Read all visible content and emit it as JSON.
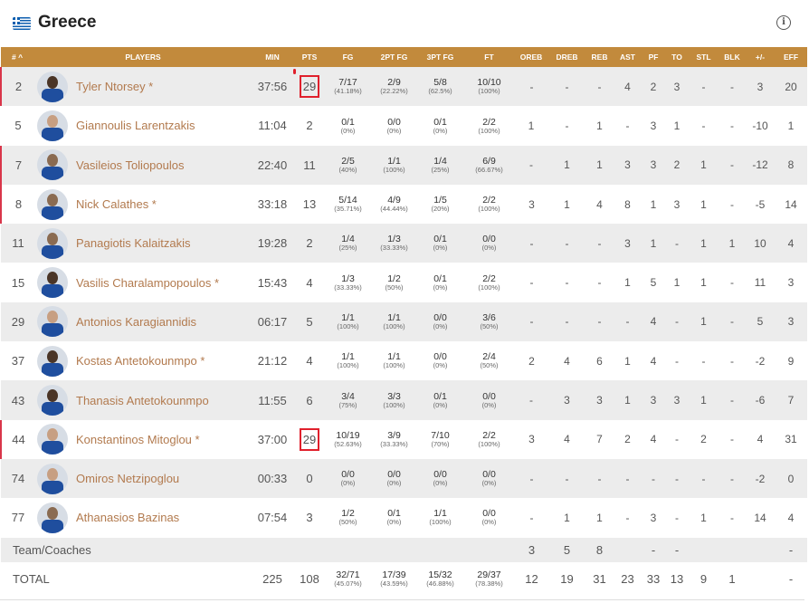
{
  "team": {
    "name": "Greece",
    "flag": "greece-flag",
    "info": "i"
  },
  "columns": [
    "# ^",
    "PLAYERS",
    "MIN",
    "PTS",
    "FG",
    "2PT FG",
    "3PT FG",
    "FT",
    "OREB",
    "DREB",
    "REB",
    "AST",
    "PF",
    "TO",
    "STL",
    "BLK",
    "+/-",
    "EFF"
  ],
  "players": [
    {
      "no": "2",
      "name": "Tyler Ntorsey *",
      "min": "37:56",
      "pts": "29",
      "fg": [
        "7/17",
        "(41.18%)"
      ],
      "fg2": [
        "2/9",
        "(22.22%)"
      ],
      "fg3": [
        "5/8",
        "(62.5%)"
      ],
      "ft": [
        "10/10",
        "(100%)"
      ],
      "oreb": "-",
      "dreb": "-",
      "reb": "-",
      "ast": "4",
      "pf": "2",
      "to": "3",
      "stl": "-",
      "blk": "-",
      "pm": "3",
      "eff": "20"
    },
    {
      "no": "5",
      "name": "Giannoulis Larentzakis",
      "min": "11:04",
      "pts": "2",
      "fg": [
        "0/1",
        "(0%)"
      ],
      "fg2": [
        "0/0",
        "(0%)"
      ],
      "fg3": [
        "0/1",
        "(0%)"
      ],
      "ft": [
        "2/2",
        "(100%)"
      ],
      "oreb": "1",
      "dreb": "-",
      "reb": "1",
      "ast": "-",
      "pf": "3",
      "to": "1",
      "stl": "-",
      "blk": "-",
      "pm": "-10",
      "eff": "1"
    },
    {
      "no": "7",
      "name": "Vasileios Toliopoulos",
      "min": "22:40",
      "pts": "11",
      "fg": [
        "2/5",
        "(40%)"
      ],
      "fg2": [
        "1/1",
        "(100%)"
      ],
      "fg3": [
        "1/4",
        "(25%)"
      ],
      "ft": [
        "6/9",
        "(66.67%)"
      ],
      "oreb": "-",
      "dreb": "1",
      "reb": "1",
      "ast": "3",
      "pf": "3",
      "to": "2",
      "stl": "1",
      "blk": "-",
      "pm": "-12",
      "eff": "8"
    },
    {
      "no": "8",
      "name": "Nick Calathes *",
      "min": "33:18",
      "pts": "13",
      "fg": [
        "5/14",
        "(35.71%)"
      ],
      "fg2": [
        "4/9",
        "(44.44%)"
      ],
      "fg3": [
        "1/5",
        "(20%)"
      ],
      "ft": [
        "2/2",
        "(100%)"
      ],
      "oreb": "3",
      "dreb": "1",
      "reb": "4",
      "ast": "8",
      "pf": "1",
      "to": "3",
      "stl": "1",
      "blk": "-",
      "pm": "-5",
      "eff": "14"
    },
    {
      "no": "11",
      "name": "Panagiotis Kalaitzakis",
      "min": "19:28",
      "pts": "2",
      "fg": [
        "1/4",
        "(25%)"
      ],
      "fg2": [
        "1/3",
        "(33.33%)"
      ],
      "fg3": [
        "0/1",
        "(0%)"
      ],
      "ft": [
        "0/0",
        "(0%)"
      ],
      "oreb": "-",
      "dreb": "-",
      "reb": "-",
      "ast": "3",
      "pf": "1",
      "to": "-",
      "stl": "1",
      "blk": "1",
      "pm": "10",
      "eff": "4"
    },
    {
      "no": "15",
      "name": "Vasilis Charalampopoulos *",
      "min": "15:43",
      "pts": "4",
      "fg": [
        "1/3",
        "(33.33%)"
      ],
      "fg2": [
        "1/2",
        "(50%)"
      ],
      "fg3": [
        "0/1",
        "(0%)"
      ],
      "ft": [
        "2/2",
        "(100%)"
      ],
      "oreb": "-",
      "dreb": "-",
      "reb": "-",
      "ast": "1",
      "pf": "5",
      "to": "1",
      "stl": "1",
      "blk": "-",
      "pm": "11",
      "eff": "3"
    },
    {
      "no": "29",
      "name": "Antonios Karagiannidis",
      "min": "06:17",
      "pts": "5",
      "fg": [
        "1/1",
        "(100%)"
      ],
      "fg2": [
        "1/1",
        "(100%)"
      ],
      "fg3": [
        "0/0",
        "(0%)"
      ],
      "ft": [
        "3/6",
        "(50%)"
      ],
      "oreb": "-",
      "dreb": "-",
      "reb": "-",
      "ast": "-",
      "pf": "4",
      "to": "-",
      "stl": "1",
      "blk": "-",
      "pm": "5",
      "eff": "3"
    },
    {
      "no": "37",
      "name": "Kostas Antetokounmpo *",
      "min": "21:12",
      "pts": "4",
      "fg": [
        "1/1",
        "(100%)"
      ],
      "fg2": [
        "1/1",
        "(100%)"
      ],
      "fg3": [
        "0/0",
        "(0%)"
      ],
      "ft": [
        "2/4",
        "(50%)"
      ],
      "oreb": "2",
      "dreb": "4",
      "reb": "6",
      "ast": "1",
      "pf": "4",
      "to": "-",
      "stl": "-",
      "blk": "-",
      "pm": "-2",
      "eff": "9"
    },
    {
      "no": "43",
      "name": "Thanasis Antetokounmpo",
      "min": "11:55",
      "pts": "6",
      "fg": [
        "3/4",
        "(75%)"
      ],
      "fg2": [
        "3/3",
        "(100%)"
      ],
      "fg3": [
        "0/1",
        "(0%)"
      ],
      "ft": [
        "0/0",
        "(0%)"
      ],
      "oreb": "-",
      "dreb": "3",
      "reb": "3",
      "ast": "1",
      "pf": "3",
      "to": "3",
      "stl": "1",
      "blk": "-",
      "pm": "-6",
      "eff": "7"
    },
    {
      "no": "44",
      "name": "Konstantinos Mitoglou *",
      "min": "37:00",
      "pts": "29",
      "fg": [
        "10/19",
        "(52.63%)"
      ],
      "fg2": [
        "3/9",
        "(33.33%)"
      ],
      "fg3": [
        "7/10",
        "(70%)"
      ],
      "ft": [
        "2/2",
        "(100%)"
      ],
      "oreb": "3",
      "dreb": "4",
      "reb": "7",
      "ast": "2",
      "pf": "4",
      "to": "-",
      "stl": "2",
      "blk": "-",
      "pm": "4",
      "eff": "31"
    },
    {
      "no": "74",
      "name": "Omiros Netzipoglou",
      "min": "00:33",
      "pts": "0",
      "fg": [
        "0/0",
        "(0%)"
      ],
      "fg2": [
        "0/0",
        "(0%)"
      ],
      "fg3": [
        "0/0",
        "(0%)"
      ],
      "ft": [
        "0/0",
        "(0%)"
      ],
      "oreb": "-",
      "dreb": "-",
      "reb": "-",
      "ast": "-",
      "pf": "-",
      "to": "-",
      "stl": "-",
      "blk": "-",
      "pm": "-2",
      "eff": "0"
    },
    {
      "no": "77",
      "name": "Athanasios Bazinas",
      "min": "07:54",
      "pts": "3",
      "fg": [
        "1/2",
        "(50%)"
      ],
      "fg2": [
        "0/1",
        "(0%)"
      ],
      "fg3": [
        "1/1",
        "(100%)"
      ],
      "ft": [
        "0/0",
        "(0%)"
      ],
      "oreb": "-",
      "dreb": "1",
      "reb": "1",
      "ast": "-",
      "pf": "3",
      "to": "-",
      "stl": "1",
      "blk": "-",
      "pm": "14",
      "eff": "4"
    }
  ],
  "team_row": {
    "label": "Team/Coaches",
    "oreb": "3",
    "dreb": "5",
    "reb": "8",
    "pf": "-",
    "to": "-",
    "eff": "-"
  },
  "total_row": {
    "label": "TOTAL",
    "min": "225",
    "pts": "108",
    "fg": [
      "32/71",
      "(45.07%)"
    ],
    "fg2": [
      "17/39",
      "(43.59%)"
    ],
    "fg3": [
      "15/32",
      "(46.88%)"
    ],
    "ft": [
      "29/37",
      "(78.38%)"
    ],
    "oreb": "12",
    "dreb": "19",
    "reb": "31",
    "ast": "23",
    "pf": "33",
    "to": "13",
    "stl": "9",
    "blk": "1",
    "pm": "",
    "eff": "-"
  }
}
